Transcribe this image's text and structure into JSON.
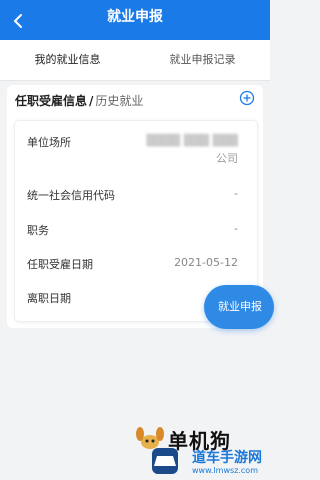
{
  "header": {
    "title": "就业申报",
    "back_icon": "chevron-left-icon"
  },
  "tabs": [
    {
      "label": "我的就业信息",
      "active": true
    },
    {
      "label": "就业申报记录",
      "active": false
    }
  ],
  "section": {
    "title": "任职受雇信息",
    "separator": "/",
    "subtitle": "历史就业",
    "add_icon": "plus-circle-icon"
  },
  "rows": [
    {
      "label": "单位场所",
      "value": "████ ███ ███ 公司"
    },
    {
      "label": "统一社会信用代码",
      "value": "-"
    },
    {
      "label": "职务",
      "value": "-"
    },
    {
      "label": "任职受雇日期",
      "value": "2021-05-12"
    },
    {
      "label": "离职日期",
      "value": ""
    }
  ],
  "company": {
    "blurred": "▒▒▒▒ ▒▒▒ ▒▒▒",
    "suffix": "公司"
  },
  "fab": {
    "label": "就业申报"
  },
  "watermark": {
    "line1": "单机狗",
    "line2": "道车手游网",
    "line3": "www.lmwsz.com"
  },
  "colors": {
    "primary": "#1a7ae8",
    "accent_red": "#e8262a",
    "fab": "#2f8ae6"
  }
}
